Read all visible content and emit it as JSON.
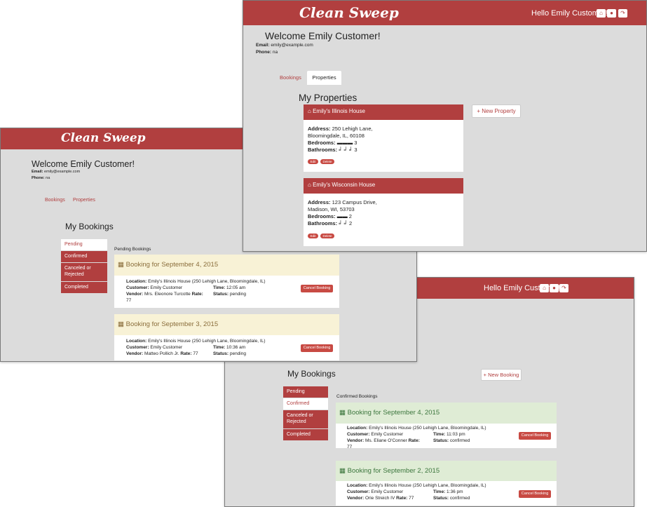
{
  "colors": {
    "brand": "#b13f3f",
    "window_bg": "#dcdcdc",
    "pending_header": "#f8f2d6",
    "confirmed_header": "#dfecd5",
    "button": "#c84a43"
  },
  "app": {
    "brand": "Clean Sweep",
    "hello": "Hello Emily Customer!"
  },
  "nav_icons": [
    "home-icon",
    "user-icon",
    "sign-out-icon"
  ],
  "user": {
    "welcome": "Welcome Emily Customer!",
    "email_label": "Email:",
    "email": "emily@example.com",
    "phone_label": "Phone:",
    "phone": "na"
  },
  "tabs": {
    "bookings": "Bookings",
    "properties": "Properties"
  },
  "properties_window": {
    "heading": "My Properties",
    "new_property": "New Property",
    "properties": [
      {
        "name": "Emily's Illinois House",
        "address_label": "Address:",
        "address_line1": "250 Lehigh Lane,",
        "address_line2": "Bloomingdale, IL, 60108",
        "bedrooms_label": "Bedrooms:",
        "bedrooms": "3",
        "bathrooms_label": "Bathrooms:",
        "bathrooms": "3",
        "edit": "Edit",
        "delete": "Delete"
      },
      {
        "name": "Emily's Wisconsin House",
        "address_label": "Address:",
        "address_line1": "123 Campus Drive,",
        "address_line2": "Madison, WI, 53703",
        "bedrooms_label": "Bedrooms:",
        "bedrooms": "2",
        "bathrooms_label": "Bathrooms:",
        "bathrooms": "2",
        "edit": "Edit",
        "delete": "Delete"
      }
    ]
  },
  "bookings_nav": {
    "pending": "Pending",
    "confirmed": "Confirmed",
    "canceled_line1": "Canceled or",
    "canceled_line2": "Rejected",
    "completed": "Completed"
  },
  "pending_window": {
    "heading": "My Bookings",
    "section_label": "Pending Bookings",
    "bookings": [
      {
        "title": "Booking for September 4, 2015",
        "location_label": "Location:",
        "location": "Emily's Illinois House (250 Lehigh Lane, Bloomingdale, IL)",
        "customer_label": "Customer:",
        "customer": "Emily Customer",
        "vendor_label": "Vendor:",
        "vendor": "Mrs. Eleonore Turcotte",
        "rate_label": "Rate:",
        "rate": "77",
        "time_label": "Time:",
        "time": "12:05 am",
        "status_label": "Status:",
        "status": "pending",
        "cancel": "Cancel Booking"
      },
      {
        "title": "Booking for September 3, 2015",
        "location_label": "Location:",
        "location": "Emily's Illinois House (250 Lehigh Lane, Bloomingdale, IL)",
        "customer_label": "Customer:",
        "customer": "Emily Customer",
        "vendor_label": "Vendor:",
        "vendor": "Matteo Pollich Jr.",
        "rate_label": "Rate:",
        "rate": "77",
        "time_label": "Time:",
        "time": "10:36 am",
        "status_label": "Status:",
        "status": "pending",
        "cancel": "Cancel Booking"
      }
    ]
  },
  "confirmed_window": {
    "heading": "My Bookings",
    "new_booking": "New Booking",
    "section_label": "Confirmed Bookings",
    "bookings": [
      {
        "title": "Booking for September 4, 2015",
        "location_label": "Location:",
        "location": "Emily's Illinois House (250 Lehigh Lane, Bloomingdale, IL)",
        "customer_label": "Customer:",
        "customer": "Emily Customer",
        "vendor_label": "Vendor:",
        "vendor": "Ms. Eliane O'Conner",
        "rate_label": "Rate:",
        "rate": "77",
        "time_label": "Time:",
        "time": "11:03 pm",
        "status_label": "Status:",
        "status": "confirmed",
        "cancel": "Cancel Booking"
      },
      {
        "title": "Booking for September 2, 2015",
        "location_label": "Location:",
        "location": "Emily's Illinois House (250 Lehigh Lane, Bloomingdale, IL)",
        "customer_label": "Customer:",
        "customer": "Emily Customer",
        "vendor_label": "Vendor:",
        "vendor": "Orie Streich IV",
        "rate_label": "Rate:",
        "rate": "77",
        "time_label": "Time:",
        "time": "1:36 pm",
        "status_label": "Status:",
        "status": "confirmed",
        "cancel": "Cancel Booking"
      }
    ]
  }
}
